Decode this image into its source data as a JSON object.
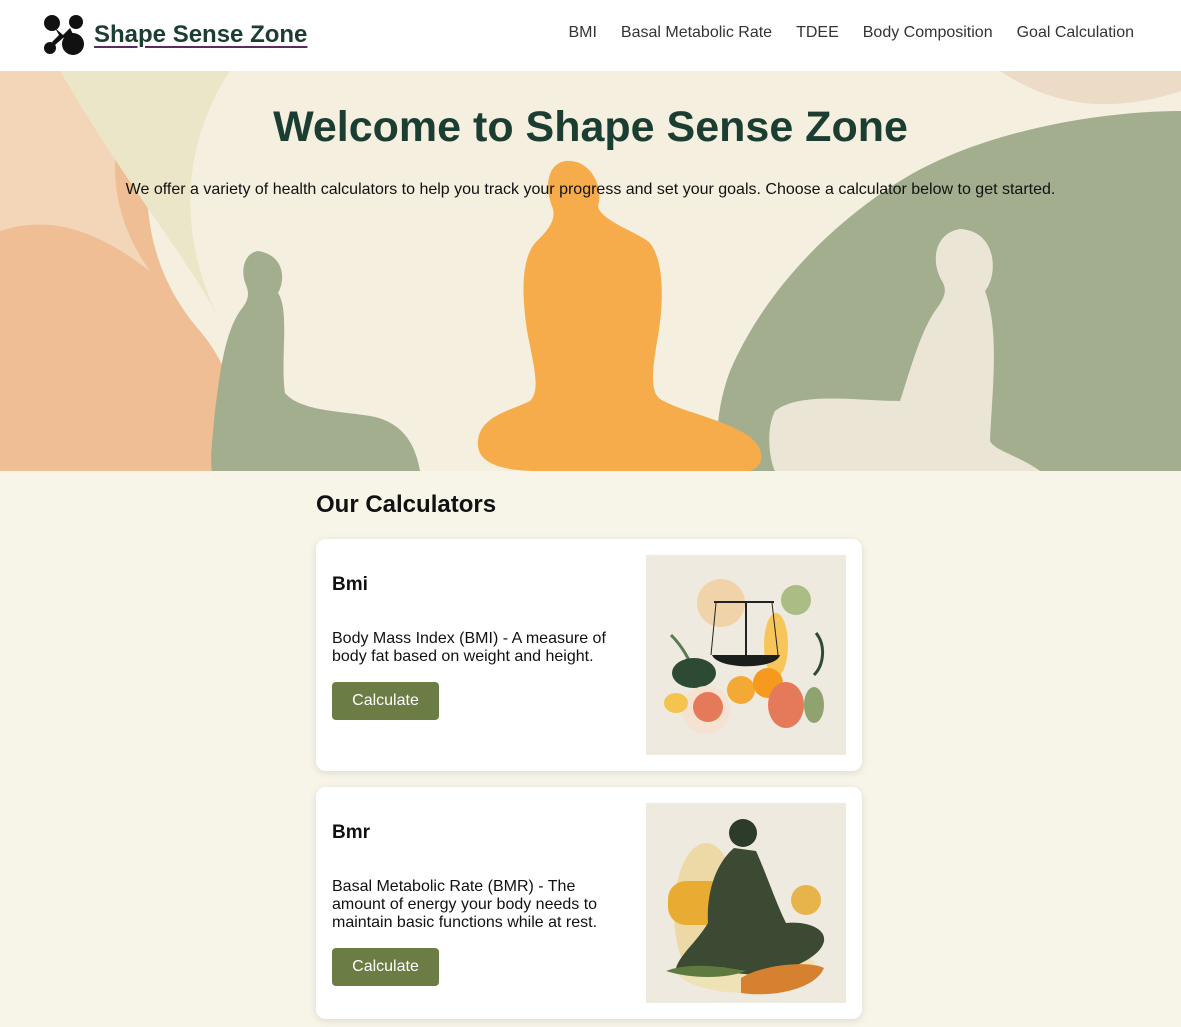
{
  "header": {
    "brand_name": "Shape Sense Zone",
    "nav": [
      {
        "label": "BMI"
      },
      {
        "label": "Basal Metabolic Rate"
      },
      {
        "label": "TDEE"
      },
      {
        "label": "Body Composition"
      },
      {
        "label": "Goal Calculation"
      }
    ]
  },
  "hero": {
    "title": "Welcome to Shape Sense Zone",
    "subtitle": "We offer a variety of health calculators to help you track your progress and set your goals. Choose a calculator below to get started."
  },
  "calculators": {
    "heading": "Our Calculators",
    "items": [
      {
        "title": "Bmi",
        "description": "Body Mass Index (BMI) - A measure of body fat based on weight and height.",
        "button_label": "Calculate",
        "image_icon": "scale-fruits-illustration"
      },
      {
        "title": "Bmr",
        "description": "Basal Metabolic Rate (BMR) - The amount of energy your body needs to maintain basic functions while at rest.",
        "button_label": "Calculate",
        "image_icon": "meditating-person-illustration"
      }
    ]
  },
  "colors": {
    "brand_dark_green": "#1c3d32",
    "button_olive": "#6b7c44",
    "page_background": "#f7f4e8",
    "hero_orange": "#f7ac4c",
    "hero_sage": "#a2ae8e"
  }
}
